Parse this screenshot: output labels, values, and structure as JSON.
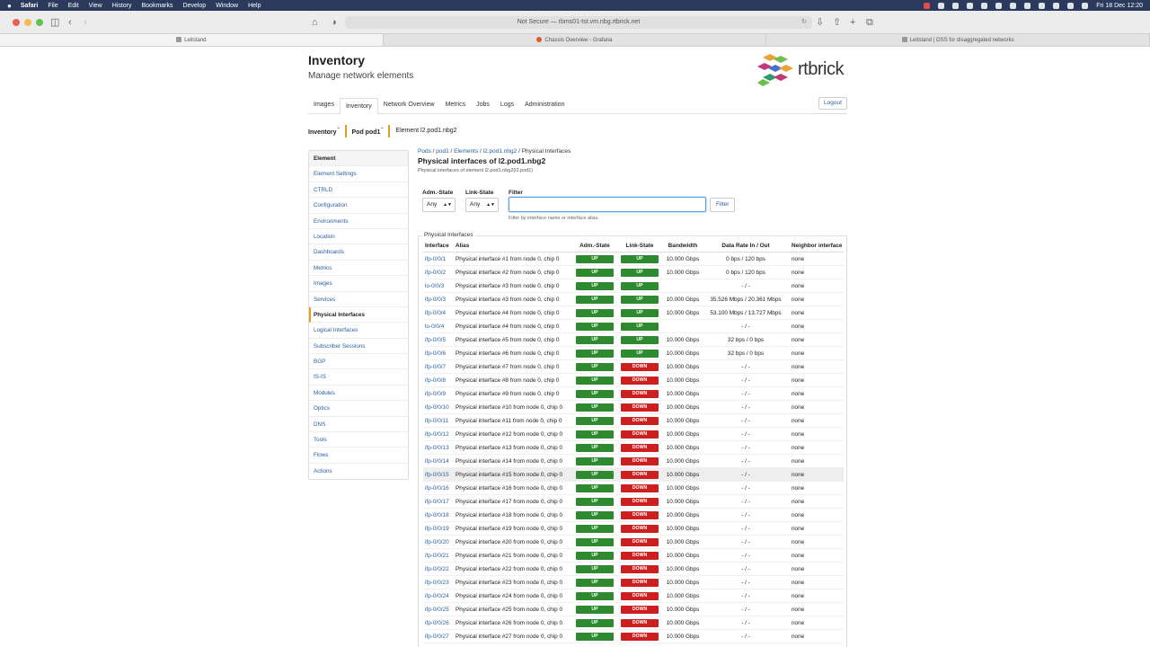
{
  "menubar": {
    "apple": "",
    "items": [
      "Safari",
      "File",
      "Edit",
      "View",
      "History",
      "Bookmarks",
      "Develop",
      "Window",
      "Help"
    ],
    "clock": "Fri 18 Dec  12:20"
  },
  "browser": {
    "address": "Not Secure — rbms01-tst.vm.nbg.rtbrick.net",
    "tabs": [
      "Leitstand",
      "Chassis Overview - Grafana",
      "Leitstand | OSS for disaggregated networks"
    ]
  },
  "header": {
    "title": "Inventory",
    "subtitle": "Manage network elements",
    "logo_text": "rtbrick",
    "logo_colors": [
      "#e8a33a",
      "#6cbf4a",
      "#c2387a",
      "#4a6fc7",
      "#2e9c6a"
    ]
  },
  "nav": {
    "tabs": [
      "Images",
      "Inventory",
      "Network Overview",
      "Metrics",
      "Jobs",
      "Logs",
      "Administration"
    ],
    "active": "Inventory",
    "logout": "Logout"
  },
  "context": {
    "inventory": "Inventory",
    "pod": "Pod pod1",
    "element": "Element l2.pod1.nbg2"
  },
  "sidebar": {
    "header": "Element",
    "items": [
      "Element Settings",
      "CTRLD",
      "Configuration",
      "Environments",
      "Location",
      "Dashboards",
      "Metrics",
      "Images",
      "Services",
      "Physical Interfaces",
      "Logical Interfaces",
      "Subscriber Sessions",
      "BGP",
      "IS-IS",
      "Modules",
      "Optics",
      "DNS",
      "Tools",
      "Flows",
      "Actions"
    ],
    "active": "Physical Interfaces"
  },
  "content": {
    "breadcrumb": {
      "pods": "Pods",
      "pod": "pod1",
      "elements": "Elements",
      "element": "l2.pod1.nbg2",
      "current": "Physical Interfaces"
    },
    "title": "Physical interfaces of l2.pod1.nbg2",
    "subtitle": "Physical interfaces of element l2.pod1.nbg2(l2.pod1)"
  },
  "filters": {
    "adm_label": "Adm.-State",
    "adm_value": "Any",
    "link_label": "Link-State",
    "link_value": "Any",
    "filter_label": "Filter",
    "filter_value": "",
    "filter_button": "Filter",
    "help": "Filter by interface name or interface alias."
  },
  "table": {
    "legend": "Physical Interfaces",
    "columns": [
      "Interface",
      "Alias",
      "Adm.-State",
      "Link-State",
      "Bandwidth",
      "Data Rate In / Out",
      "Neighbor interface"
    ],
    "rows": [
      [
        "ifp-0/0/1",
        "Physical interface #1 from node 0, chip 0",
        "UP",
        "UP",
        "10.000 Gbps",
        "0 bps / 120 bps",
        "none"
      ],
      [
        "ifp-0/0/2",
        "Physical interface #2 from node 0, chip 0",
        "UP",
        "UP",
        "10.000 Gbps",
        "0 bps / 120 bps",
        "none"
      ],
      [
        "lo-0/0/3",
        "Physical interface #3 from node 0, chip 0",
        "UP",
        "UP",
        "",
        "- / -",
        "none"
      ],
      [
        "ifp-0/0/3",
        "Physical interface #3 from node 0, chip 0",
        "UP",
        "UP",
        "10.000 Gbps",
        "35.526 Mbps / 20.361 Mbps",
        "none"
      ],
      [
        "ifp-0/0/4",
        "Physical interface #4 from node 0, chip 0",
        "UP",
        "UP",
        "10.000 Gbps",
        "53.100 Mbps / 13.727 Mbps",
        "none"
      ],
      [
        "lo-0/0/4",
        "Physical interface #4 from node 0, chip 0",
        "UP",
        "UP",
        "",
        "- / -",
        "none"
      ],
      [
        "ifp-0/0/5",
        "Physical interface #5 from node 0, chip 0",
        "UP",
        "UP",
        "10.000 Gbps",
        "32 bps / 0 bps",
        "none"
      ],
      [
        "ifp-0/0/6",
        "Physical interface #6 from node 0, chip 0",
        "UP",
        "UP",
        "10.000 Gbps",
        "32 bps / 0 bps",
        "none"
      ],
      [
        "ifp-0/0/7",
        "Physical interface #7 from node 0, chip 0",
        "UP",
        "DOWN",
        "10.000 Gbps",
        "- / -",
        "none"
      ],
      [
        "ifp-0/0/8",
        "Physical interface #8 from node 0, chip 0",
        "UP",
        "DOWN",
        "10.000 Gbps",
        "- / -",
        "none"
      ],
      [
        "ifp-0/0/9",
        "Physical interface #9 from node 0, chip 0",
        "UP",
        "DOWN",
        "10.000 Gbps",
        "- / -",
        "none"
      ],
      [
        "ifp-0/0/10",
        "Physical interface #10 from node 0, chip 0",
        "UP",
        "DOWN",
        "10.000 Gbps",
        "- / -",
        "none"
      ],
      [
        "ifp-0/0/11",
        "Physical interface #11 from node 0, chip 0",
        "UP",
        "DOWN",
        "10.000 Gbps",
        "- / -",
        "none"
      ],
      [
        "ifp-0/0/12",
        "Physical interface #12 from node 0, chip 0",
        "UP",
        "DOWN",
        "10.000 Gbps",
        "- / -",
        "none"
      ],
      [
        "ifp-0/0/13",
        "Physical interface #13 from node 0, chip 0",
        "UP",
        "DOWN",
        "10.000 Gbps",
        "- / -",
        "none"
      ],
      [
        "ifp-0/0/14",
        "Physical interface #14 from node 0, chip 0",
        "UP",
        "DOWN",
        "10.000 Gbps",
        "- / -",
        "none"
      ],
      [
        "ifp-0/0/15",
        "Physical interface #15 from node 0, chip 0",
        "UP",
        "DOWN",
        "10.000 Gbps",
        "- / -",
        "none"
      ],
      [
        "ifp-0/0/16",
        "Physical interface #16 from node 0, chip 0",
        "UP",
        "DOWN",
        "10.000 Gbps",
        "- / -",
        "none"
      ],
      [
        "ifp-0/0/17",
        "Physical interface #17 from node 0, chip 0",
        "UP",
        "DOWN",
        "10.000 Gbps",
        "- / -",
        "none"
      ],
      [
        "ifp-0/0/18",
        "Physical interface #18 from node 0, chip 0",
        "UP",
        "DOWN",
        "10.000 Gbps",
        "- / -",
        "none"
      ],
      [
        "ifp-0/0/19",
        "Physical interface #19 from node 0, chip 0",
        "UP",
        "DOWN",
        "10.000 Gbps",
        "- / -",
        "none"
      ],
      [
        "ifp-0/0/20",
        "Physical interface #20 from node 0, chip 0",
        "UP",
        "DOWN",
        "10.000 Gbps",
        "- / -",
        "none"
      ],
      [
        "ifp-0/0/21",
        "Physical interface #21 from node 0, chip 0",
        "UP",
        "DOWN",
        "10.000 Gbps",
        "- / -",
        "none"
      ],
      [
        "ifp-0/0/22",
        "Physical interface #22 from node 0, chip 0",
        "UP",
        "DOWN",
        "10.000 Gbps",
        "- / -",
        "none"
      ],
      [
        "ifp-0/0/23",
        "Physical interface #23 from node 0, chip 0",
        "UP",
        "DOWN",
        "10.000 Gbps",
        "- / -",
        "none"
      ],
      [
        "ifp-0/0/24",
        "Physical interface #24 from node 0, chip 0",
        "UP",
        "DOWN",
        "10.000 Gbps",
        "- / -",
        "none"
      ],
      [
        "ifp-0/0/25",
        "Physical interface #25 from node 0, chip 0",
        "UP",
        "DOWN",
        "10.000 Gbps",
        "- / -",
        "none"
      ],
      [
        "ifp-0/0/26",
        "Physical interface #26 from node 0, chip 0",
        "UP",
        "DOWN",
        "10.000 Gbps",
        "- / -",
        "none"
      ],
      [
        "ifp-0/0/27",
        "Physical interface #27 from node 0, chip 0",
        "UP",
        "DOWN",
        "10.000 Gbps",
        "- / -",
        "none"
      ]
    ],
    "hover_interface": "ifp-0/0/15"
  }
}
